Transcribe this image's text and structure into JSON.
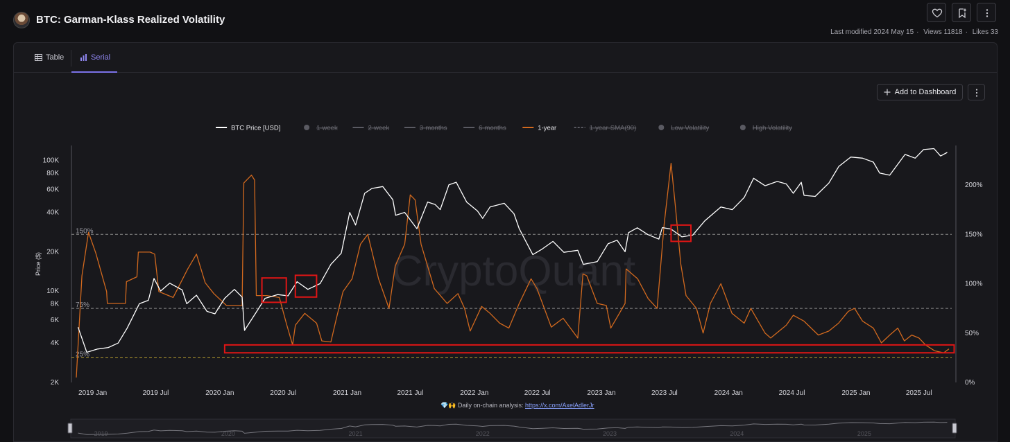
{
  "header": {
    "title": "BTC: Garman-Klass Realized Volatility",
    "last_modified": "Last modified 2024 May 15",
    "views": "Views 11818",
    "likes": "Likes 33"
  },
  "tabs": [
    {
      "label": "Table",
      "active": false
    },
    {
      "label": "Serial",
      "active": true
    }
  ],
  "toolbar": {
    "add_dashboard_label": "Add to Dashboard"
  },
  "footnote": {
    "emoji": "💎🙌",
    "text": "Daily on-chain analysis:",
    "link_text": "https://x.com/AxelAdlerJr"
  },
  "colors": {
    "price": "#ffffff",
    "volatility_1y": "#d2691e",
    "accent": "#7c73ea",
    "highlight_box": "#e01515",
    "reference_line_75_150": "#8a8a8a",
    "reference_line_25": "#b8a030"
  },
  "watermark": "CryptoQuant",
  "chart_data": {
    "type": "line",
    "legend_placement": "top-center",
    "grid": true,
    "legend": [
      {
        "name": "BTC Price [USD]",
        "style": "line",
        "color": "#ffffff",
        "visible": true
      },
      {
        "name": "1-week",
        "style": "dot",
        "color": "#5a5a62",
        "visible": false
      },
      {
        "name": "2-week",
        "style": "line",
        "color": "#5a5a62",
        "visible": false
      },
      {
        "name": "3-months",
        "style": "line",
        "color": "#5a5a62",
        "visible": false
      },
      {
        "name": "6-months",
        "style": "line",
        "color": "#5a5a62",
        "visible": false
      },
      {
        "name": "1-year",
        "style": "line",
        "color": "#d2691e",
        "visible": true
      },
      {
        "name": "1-year-SMA(90)",
        "style": "dash",
        "color": "#5a5a62",
        "visible": false
      },
      {
        "name": "Low Volatility",
        "style": "dot",
        "color": "#5a5a62",
        "visible": false
      },
      {
        "name": "High Volatility",
        "style": "dot",
        "color": "#5a5a62",
        "visible": false
      }
    ],
    "x_range": [
      "2018-11-01",
      "2025-10-15"
    ],
    "x_ticks": [
      "2019 Jan",
      "2019 Jul",
      "2020 Jan",
      "2020 Jul",
      "2021 Jan",
      "2021 Jul",
      "2022 Jan",
      "2022 Jul",
      "2023 Jan",
      "2023 Jul",
      "2024 Jan",
      "2024 Jul",
      "2025 Jan",
      "2025 Jul"
    ],
    "x_tick_dates": [
      "2019-01-01",
      "2019-07-01",
      "2020-01-01",
      "2020-07-01",
      "2021-01-01",
      "2021-07-01",
      "2022-01-01",
      "2022-07-01",
      "2023-01-01",
      "2023-07-01",
      "2024-01-01",
      "2024-07-01",
      "2025-01-01",
      "2025-07-01"
    ],
    "y_left": {
      "label": "Price ($)",
      "scale": "log",
      "range": [
        2000,
        130000
      ],
      "ticks": [
        2000,
        4000,
        6000,
        8000,
        10000,
        20000,
        40000,
        60000,
        80000,
        100000
      ],
      "tick_labels": [
        "2K",
        "4K",
        "6K",
        "8K",
        "10K",
        "20K",
        "40K",
        "60K",
        "80K",
        "100K"
      ]
    },
    "y_right": {
      "scale": "linear",
      "range": [
        0,
        240
      ],
      "ticks": [
        0,
        50,
        100,
        150,
        200
      ],
      "tick_labels": [
        "0%",
        "50%",
        "100%",
        "150%",
        "200%"
      ]
    },
    "reference_lines": [
      {
        "label": "150%",
        "value": 150,
        "axis": "right",
        "style": "dashed"
      },
      {
        "label": "75%",
        "value": 75,
        "axis": "right",
        "style": "dashed"
      },
      {
        "label": "25%",
        "value": 25,
        "axis": "right",
        "style": "dashed"
      }
    ],
    "series": [
      {
        "name": "BTC Price [USD]",
        "axis": "left",
        "points": [
          [
            "2018-11-20",
            5300
          ],
          [
            "2018-12-15",
            3400
          ],
          [
            "2019-01-15",
            3600
          ],
          [
            "2019-02-15",
            3700
          ],
          [
            "2019-03-15",
            4000
          ],
          [
            "2019-04-10",
            5200
          ],
          [
            "2019-05-15",
            8000
          ],
          [
            "2019-06-10",
            8500
          ],
          [
            "2019-06-26",
            12500
          ],
          [
            "2019-07-15",
            10000
          ],
          [
            "2019-08-10",
            11500
          ],
          [
            "2019-09-15",
            10200
          ],
          [
            "2019-09-28",
            8000
          ],
          [
            "2019-10-26",
            9300
          ],
          [
            "2019-11-25",
            7000
          ],
          [
            "2019-12-18",
            6700
          ],
          [
            "2020-01-15",
            8800
          ],
          [
            "2020-02-12",
            10300
          ],
          [
            "2020-03-05",
            9000
          ],
          [
            "2020-03-12",
            5000
          ],
          [
            "2020-04-15",
            6900
          ],
          [
            "2020-05-10",
            8800
          ],
          [
            "2020-06-15",
            9400
          ],
          [
            "2020-07-15",
            9200
          ],
          [
            "2020-08-10",
            11800
          ],
          [
            "2020-09-10",
            10300
          ],
          [
            "2020-10-15",
            11400
          ],
          [
            "2020-11-15",
            16000
          ],
          [
            "2020-12-15",
            19500
          ],
          [
            "2021-01-08",
            40000
          ],
          [
            "2021-01-25",
            32000
          ],
          [
            "2021-02-20",
            56000
          ],
          [
            "2021-03-13",
            61000
          ],
          [
            "2021-04-13",
            63000
          ],
          [
            "2021-05-12",
            50000
          ],
          [
            "2021-05-20",
            38000
          ],
          [
            "2021-06-15",
            40000
          ],
          [
            "2021-07-20",
            30000
          ],
          [
            "2021-08-20",
            48000
          ],
          [
            "2021-09-10",
            46000
          ],
          [
            "2021-09-25",
            42000
          ],
          [
            "2021-10-20",
            65000
          ],
          [
            "2021-11-10",
            68000
          ],
          [
            "2021-12-10",
            48000
          ],
          [
            "2022-01-10",
            41000
          ],
          [
            "2022-01-25",
            36000
          ],
          [
            "2022-02-15",
            44000
          ],
          [
            "2022-03-28",
            47000
          ],
          [
            "2022-04-25",
            39000
          ],
          [
            "2022-05-10",
            30000
          ],
          [
            "2022-06-18",
            19000
          ],
          [
            "2022-07-15",
            21000
          ],
          [
            "2022-08-15",
            24000
          ],
          [
            "2022-09-15",
            19800
          ],
          [
            "2022-10-25",
            20500
          ],
          [
            "2022-11-10",
            16000
          ],
          [
            "2022-12-20",
            16800
          ],
          [
            "2023-01-20",
            23000
          ],
          [
            "2023-02-15",
            24500
          ],
          [
            "2023-03-10",
            20000
          ],
          [
            "2023-03-20",
            28000
          ],
          [
            "2023-04-14",
            30500
          ],
          [
            "2023-05-15",
            27000
          ],
          [
            "2023-06-15",
            25000
          ],
          [
            "2023-06-25",
            30600
          ],
          [
            "2023-07-20",
            29800
          ],
          [
            "2023-08-20",
            26000
          ],
          [
            "2023-09-20",
            26800
          ],
          [
            "2023-10-25",
            34500
          ],
          [
            "2023-12-10",
            44000
          ],
          [
            "2024-01-12",
            42000
          ],
          [
            "2024-02-15",
            52000
          ],
          [
            "2024-03-13",
            73000
          ],
          [
            "2024-04-15",
            64000
          ],
          [
            "2024-05-20",
            69000
          ],
          [
            "2024-06-15",
            66000
          ],
          [
            "2024-07-05",
            56000
          ],
          [
            "2024-07-28",
            68000
          ],
          [
            "2024-08-05",
            54000
          ],
          [
            "2024-09-06",
            53000
          ],
          [
            "2024-10-15",
            67000
          ],
          [
            "2024-11-13",
            90000
          ],
          [
            "2024-12-17",
            106000
          ],
          [
            "2025-01-20",
            104000
          ],
          [
            "2025-02-20",
            97000
          ],
          [
            "2025-03-10",
            80000
          ],
          [
            "2025-04-08",
            77000
          ],
          [
            "2025-05-22",
            111000
          ],
          [
            "2025-06-20",
            104000
          ],
          [
            "2025-07-14",
            121000
          ],
          [
            "2025-08-13",
            123000
          ],
          [
            "2025-09-01",
            108000
          ],
          [
            "2025-09-20",
            115000
          ]
        ]
      },
      {
        "name": "1-year",
        "axis": "right",
        "points": [
          [
            "2018-11-15",
            5
          ],
          [
            "2018-12-01",
            108
          ],
          [
            "2018-12-20",
            152
          ],
          [
            "2019-01-10",
            131
          ],
          [
            "2019-02-10",
            92
          ],
          [
            "2019-02-12",
            80
          ],
          [
            "2019-04-05",
            80
          ],
          [
            "2019-04-08",
            102
          ],
          [
            "2019-05-08",
            107
          ],
          [
            "2019-05-12",
            132
          ],
          [
            "2019-06-15",
            132
          ],
          [
            "2019-06-28",
            130
          ],
          [
            "2019-07-10",
            92
          ],
          [
            "2019-08-20",
            86
          ],
          [
            "2019-10-01",
            115
          ],
          [
            "2019-10-26",
            130
          ],
          [
            "2019-11-20",
            101
          ],
          [
            "2019-12-15",
            90
          ],
          [
            "2020-01-20",
            78
          ],
          [
            "2020-03-05",
            78
          ],
          [
            "2020-03-10",
            202
          ],
          [
            "2020-04-01",
            210
          ],
          [
            "2020-04-10",
            205
          ],
          [
            "2020-04-15",
            88
          ],
          [
            "2020-05-15",
            88
          ],
          [
            "2020-06-20",
            86
          ],
          [
            "2020-07-10",
            60
          ],
          [
            "2020-07-28",
            38
          ],
          [
            "2020-08-05",
            58
          ],
          [
            "2020-09-01",
            70
          ],
          [
            "2020-10-05",
            60
          ],
          [
            "2020-10-20",
            42
          ],
          [
            "2020-11-15",
            41
          ],
          [
            "2020-12-01",
            65
          ],
          [
            "2020-12-20",
            92
          ],
          [
            "2021-01-15",
            105
          ],
          [
            "2021-02-08",
            140
          ],
          [
            "2021-03-01",
            150
          ],
          [
            "2021-04-01",
            105
          ],
          [
            "2021-05-01",
            75
          ],
          [
            "2021-05-19",
            118
          ],
          [
            "2021-06-15",
            140
          ],
          [
            "2021-07-01",
            190
          ],
          [
            "2021-07-15",
            185
          ],
          [
            "2021-08-01",
            140
          ],
          [
            "2021-09-08",
            95
          ],
          [
            "2021-10-15",
            80
          ],
          [
            "2021-11-15",
            90
          ],
          [
            "2021-12-04",
            75
          ],
          [
            "2021-12-20",
            52
          ],
          [
            "2022-01-22",
            77
          ],
          [
            "2022-02-15",
            70
          ],
          [
            "2022-03-15",
            60
          ],
          [
            "2022-04-10",
            55
          ],
          [
            "2022-05-10",
            80
          ],
          [
            "2022-06-13",
            105
          ],
          [
            "2022-06-30",
            95
          ],
          [
            "2022-08-10",
            56
          ],
          [
            "2022-09-13",
            65
          ],
          [
            "2022-10-25",
            45
          ],
          [
            "2022-11-09",
            110
          ],
          [
            "2022-11-20",
            108
          ],
          [
            "2022-12-20",
            80
          ],
          [
            "2023-01-15",
            78
          ],
          [
            "2023-01-28",
            55
          ],
          [
            "2023-03-10",
            80
          ],
          [
            "2023-03-13",
            115
          ],
          [
            "2023-04-15",
            105
          ],
          [
            "2023-05-15",
            85
          ],
          [
            "2023-06-10",
            75
          ],
          [
            "2023-06-30",
            160
          ],
          [
            "2023-07-20",
            222
          ],
          [
            "2023-08-01",
            180
          ],
          [
            "2023-08-17",
            120
          ],
          [
            "2023-09-01",
            88
          ],
          [
            "2023-10-01",
            75
          ],
          [
            "2023-10-20",
            50
          ],
          [
            "2023-11-10",
            80
          ],
          [
            "2023-12-10",
            100
          ],
          [
            "2024-01-11",
            70
          ],
          [
            "2024-02-15",
            60
          ],
          [
            "2024-03-05",
            75
          ],
          [
            "2024-04-15",
            50
          ],
          [
            "2024-05-01",
            45
          ],
          [
            "2024-06-15",
            58
          ],
          [
            "2024-07-05",
            68
          ],
          [
            "2024-08-05",
            62
          ],
          [
            "2024-09-15",
            48
          ],
          [
            "2024-10-15",
            52
          ],
          [
            "2024-11-12",
            60
          ],
          [
            "2024-12-10",
            72
          ],
          [
            "2024-12-28",
            75
          ],
          [
            "2025-01-20",
            62
          ],
          [
            "2025-02-20",
            55
          ],
          [
            "2025-03-15",
            40
          ],
          [
            "2025-04-08",
            48
          ],
          [
            "2025-05-01",
            55
          ],
          [
            "2025-05-20",
            42
          ],
          [
            "2025-06-10",
            48
          ],
          [
            "2025-07-01",
            45
          ],
          [
            "2025-07-20",
            38
          ],
          [
            "2025-08-15",
            32
          ],
          [
            "2025-09-10",
            30
          ],
          [
            "2025-09-25",
            34
          ]
        ]
      }
    ],
    "annotations": [
      {
        "type": "rectangle",
        "color": "#e01515",
        "x_range": [
          "2020-05-01",
          "2020-07-10"
        ],
        "y_range_left": [
          8200,
          12600
        ]
      },
      {
        "type": "rectangle",
        "color": "#e01515",
        "x_range": [
          "2020-08-05",
          "2020-10-05"
        ],
        "y_range_left": [
          9000,
          13200
        ]
      },
      {
        "type": "rectangle",
        "color": "#e01515",
        "x_range": [
          "2023-07-20",
          "2023-09-15"
        ],
        "y_range_left": [
          24000,
          32000
        ]
      },
      {
        "type": "rectangle",
        "color": "#e01515",
        "x_range": [
          "2020-01-15",
          "2025-10-10"
        ],
        "y_range_right": [
          30,
          38
        ]
      }
    ]
  },
  "navigator": {
    "years": [
      "2019",
      "2020",
      "2021",
      "2022",
      "2023",
      "2024",
      "2025"
    ]
  }
}
